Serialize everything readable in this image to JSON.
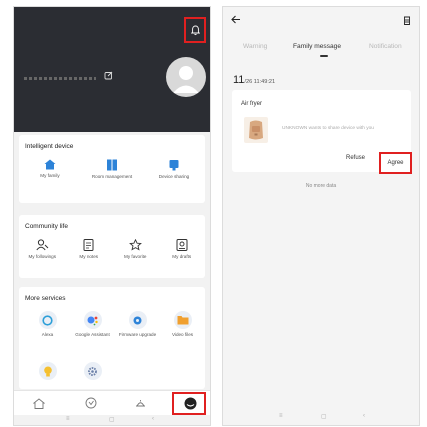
{
  "left": {
    "header": {
      "icons": {
        "bell": "bell-icon",
        "edit": "edit-icon",
        "avatar": "avatar-icon"
      }
    },
    "intelligent_device": {
      "title": "Intelligent device",
      "items": [
        {
          "label": "My family",
          "icon": "home-icon"
        },
        {
          "label": "Room management",
          "icon": "room-icon"
        },
        {
          "label": "Device sharing",
          "icon": "share-icon"
        }
      ]
    },
    "community_life": {
      "title": "Community life",
      "items": [
        {
          "label": "My followings",
          "icon": "followings-icon"
        },
        {
          "label": "My notes",
          "icon": "notes-icon"
        },
        {
          "label": "My favorite",
          "icon": "star-icon"
        },
        {
          "label": "My drafts",
          "icon": "drafts-icon"
        }
      ]
    },
    "more_services": {
      "title": "More services",
      "items": [
        {
          "label": "Alexa",
          "icon": "alexa-icon"
        },
        {
          "label": "Google Assistant",
          "icon": "google-assistant-icon"
        },
        {
          "label": "Firmware upgrade",
          "icon": "firmware-icon"
        },
        {
          "label": "Video files",
          "icon": "folder-icon"
        },
        {
          "label": "",
          "icon": "bulb-icon"
        },
        {
          "label": "",
          "icon": "settings-icon"
        }
      ]
    },
    "bottom_nav": [
      "home-icon",
      "explore-icon",
      "cook-icon",
      "profile-icon"
    ],
    "system_nav": [
      "≡",
      "▢",
      "‹"
    ]
  },
  "right": {
    "tabs": {
      "warning": "Warning",
      "family": "Family message",
      "notification": "Notification",
      "active": "family"
    },
    "time": {
      "day": "11",
      "rest": "/26  11:49:21"
    },
    "message": {
      "title": "Air fryer",
      "text": "UNKNOWN wants to share device with you",
      "refuse": "Refuse",
      "agree": "Agree"
    },
    "no_more": "No more data",
    "system_nav": [
      "≡",
      "▢",
      "‹"
    ]
  },
  "colors": {
    "accent_highlight": "#e02020",
    "header_bg": "#2b2d33",
    "icon_blue": "#2d83d8"
  }
}
